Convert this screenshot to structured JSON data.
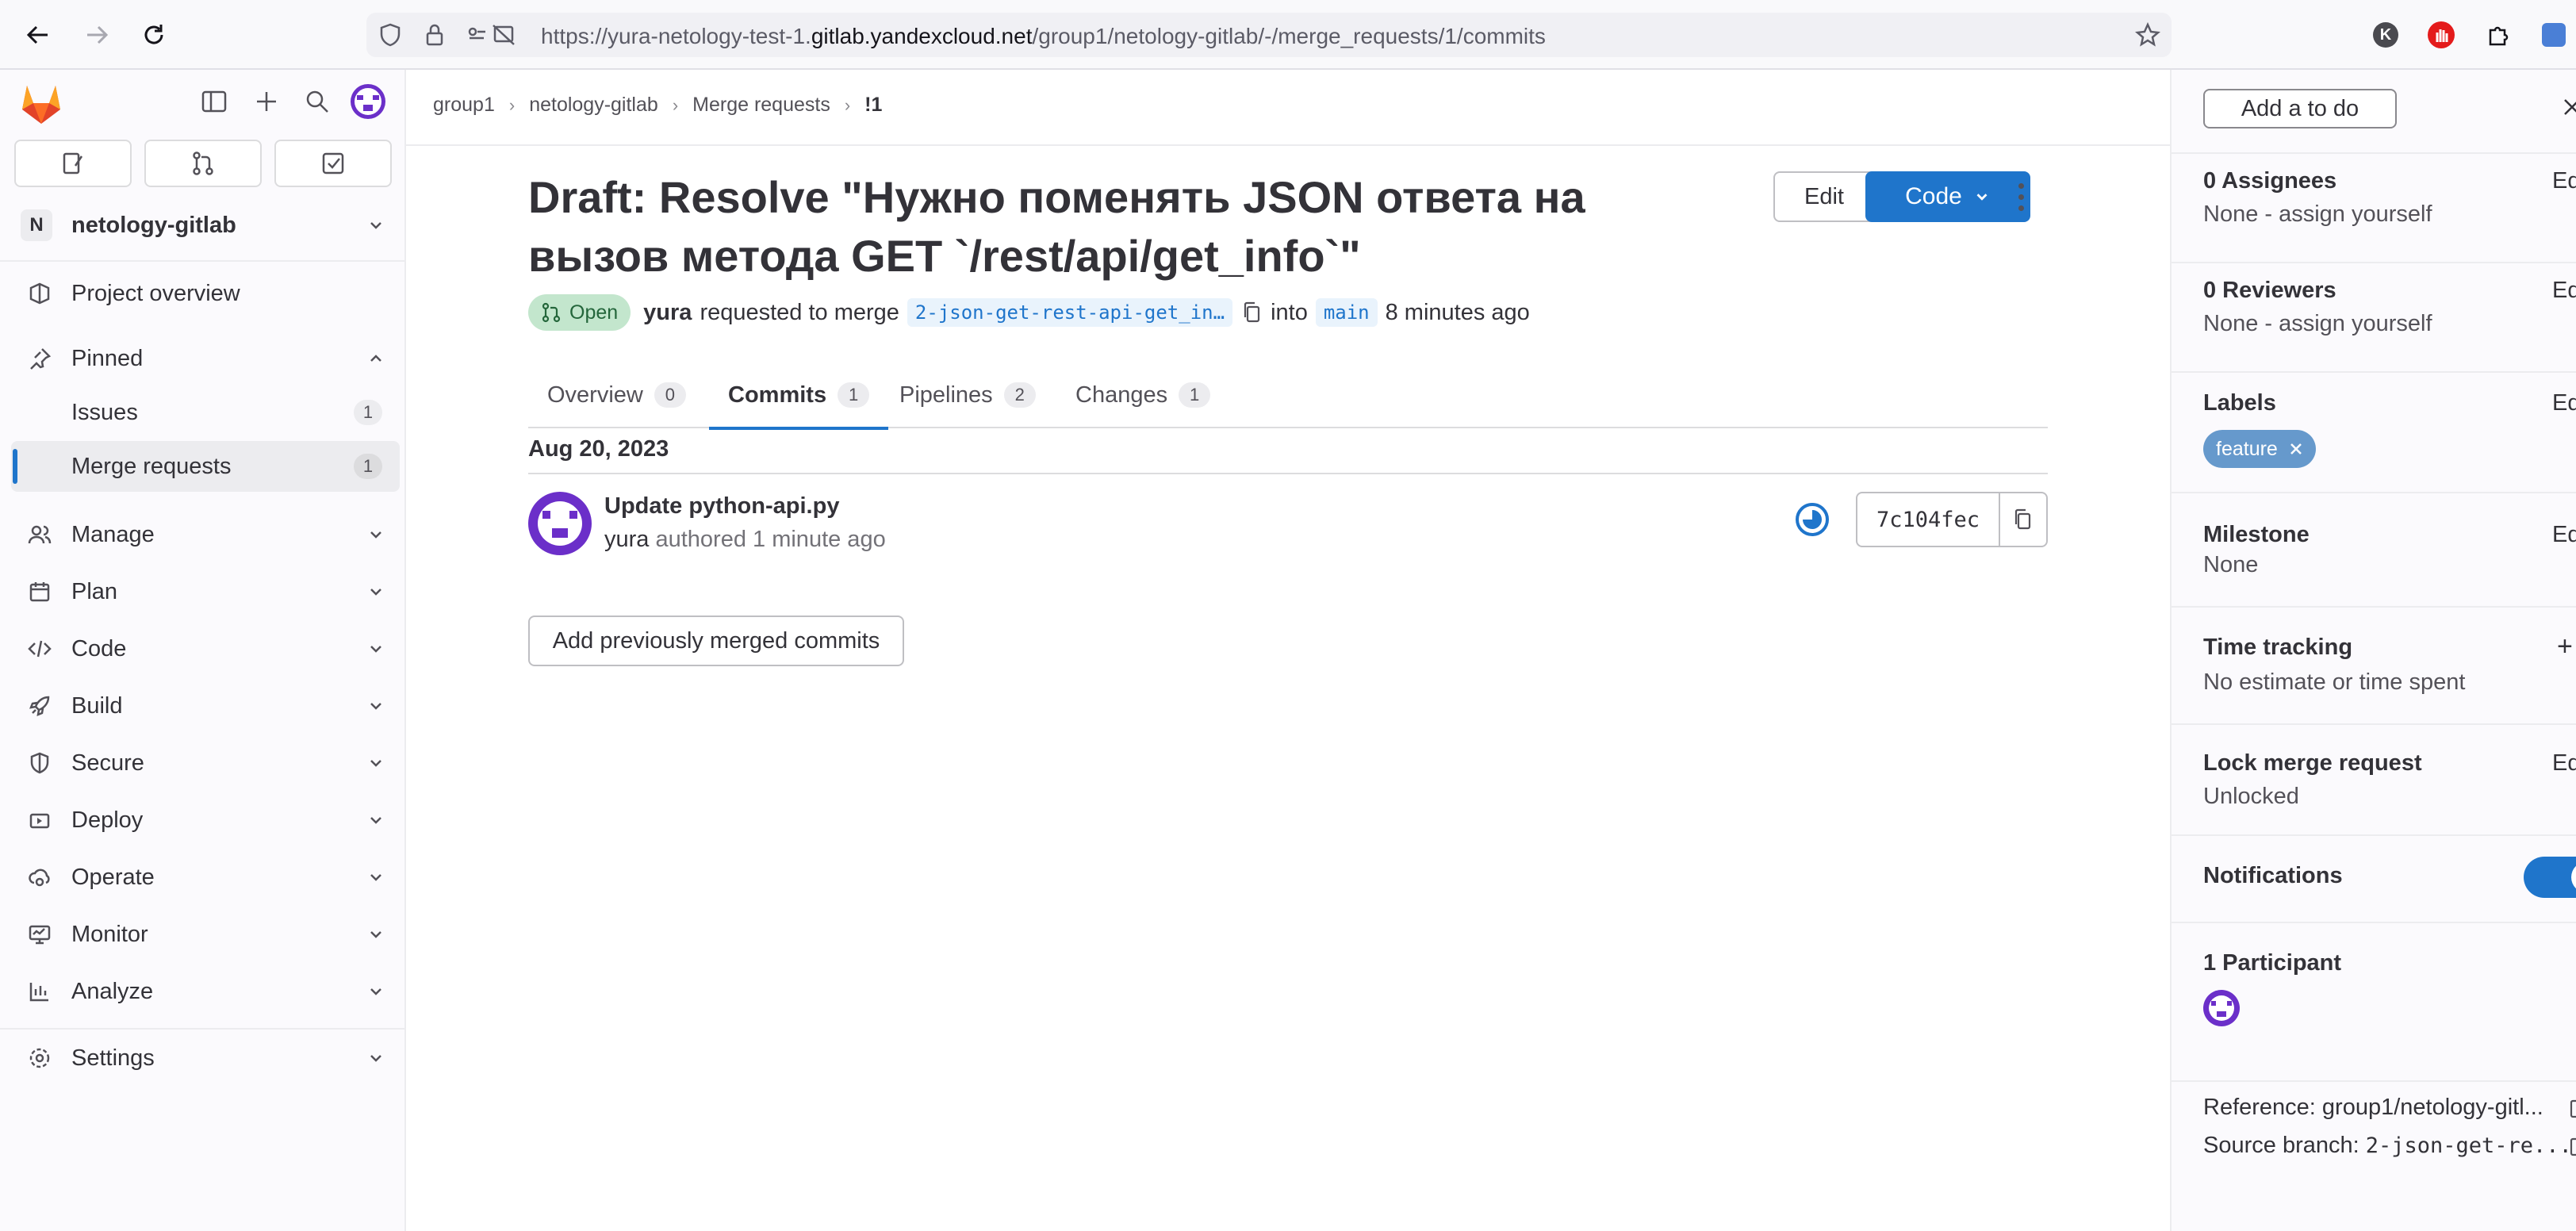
{
  "browser": {
    "url_prefix": "https://yura-netology-test-1.",
    "url_host": "gitlab.yandexcloud.net",
    "url_path": "/group1/netology-gitlab/-/merge_requests/1/commits",
    "ext_k_label": "K"
  },
  "sidebar": {
    "project_initial": "N",
    "project_name": "netology-gitlab",
    "items": {
      "project_overview": "Project overview",
      "pinned": "Pinned",
      "issues": "Issues",
      "issues_count": "1",
      "merge_requests": "Merge requests",
      "merge_requests_count": "1",
      "manage": "Manage",
      "plan": "Plan",
      "code": "Code",
      "build": "Build",
      "secure": "Secure",
      "deploy": "Deploy",
      "operate": "Operate",
      "monitor": "Monitor",
      "analyze": "Analyze",
      "settings": "Settings"
    }
  },
  "breadcrumb": [
    "group1",
    "netology-gitlab",
    "Merge requests",
    "!1"
  ],
  "mr": {
    "title": "Draft: Resolve \"Нужно поменять JSON ответа на вызов метода GET `/rest/api/get_info`\"",
    "edit_label": "Edit",
    "code_label": "Code",
    "status": "Open",
    "author": "yura",
    "requested_text": "requested to merge",
    "source_branch": "2-json-get-rest-api-get_in…",
    "into_text": "into",
    "target_branch": "main",
    "time_ago": "8 minutes ago"
  },
  "tabs": [
    {
      "label": "Overview",
      "count": "0"
    },
    {
      "label": "Commits",
      "count": "1"
    },
    {
      "label": "Pipelines",
      "count": "2"
    },
    {
      "label": "Changes",
      "count": "1"
    }
  ],
  "commits": {
    "date": "Aug 20, 2023",
    "title": "Update python-api.py",
    "author": "yura",
    "authored_text": "authored 1 minute ago",
    "sha": "7c104fec",
    "add_previous_label": "Add previously merged commits"
  },
  "right_sidebar": {
    "todo_label": "Add a to do",
    "assignees_title": "0 Assignees",
    "assignees_value": "None - assign yourself",
    "reviewers_title": "0 Reviewers",
    "reviewers_value": "None - assign yourself",
    "labels_title": "Labels",
    "label_chip": "feature",
    "milestone_title": "Milestone",
    "milestone_value": "None",
    "time_tracking_title": "Time tracking",
    "time_tracking_value": "No estimate or time spent",
    "lock_title": "Lock merge request",
    "lock_value": "Unlocked",
    "notifications_title": "Notifications",
    "participants_title": "1 Participant",
    "reference": "Reference: group1/netology-gitl...",
    "source_branch_label": "Source branch:",
    "source_branch_value": "2-json-get-re...",
    "edit_short": "Ed",
    "plus": "+"
  },
  "colors": {
    "accent": "#1f75cb",
    "status_open_bg": "#c3e6cd",
    "label_feature": "#6699cc",
    "avatar_purple": "#6b2fc9"
  }
}
